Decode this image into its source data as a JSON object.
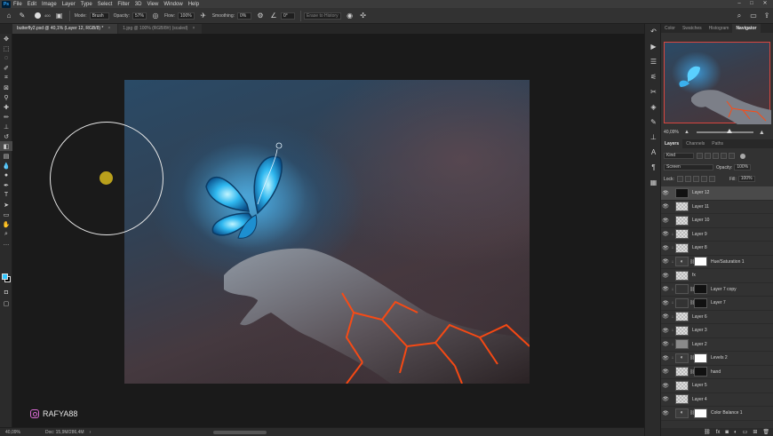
{
  "menu": [
    "File",
    "Edit",
    "Image",
    "Layer",
    "Type",
    "Select",
    "Filter",
    "3D",
    "View",
    "Window",
    "Help"
  ],
  "options": {
    "mode_label": "Mode:",
    "mode_value": "Brush",
    "opacity_label": "Opacity:",
    "opacity_value": "57%",
    "flow_label": "Flow:",
    "flow_value": "100%",
    "smoothing_label": "Smoothing:",
    "smoothing_value": "0%",
    "angle_value": "0°",
    "erase_history": "Erase to History",
    "brush_size": "400"
  },
  "tabs": [
    {
      "label": "butterfly2.psd @ 40,1% (Layer 12, RGB/8) *",
      "active": true
    },
    {
      "label": "1.jpg @ 100% (RGB/8#) (scaled)",
      "active": false
    }
  ],
  "watermark": "RAFYA88",
  "status": {
    "zoom": "40,09%",
    "doc": "Doc: 15,9M/286,4M"
  },
  "panel_tabs": [
    "Color",
    "Swatches",
    "Histogram",
    "Navigator"
  ],
  "navigator": {
    "zoom": "40,09%"
  },
  "layer_panel_tabs": [
    "Layers",
    "Channels",
    "Paths"
  ],
  "layer_controls": {
    "kind": "Kind",
    "blend_mode": "Screen",
    "opacity_label": "Opacity:",
    "opacity_value": "100%",
    "lock_label": "Lock:",
    "fill_label": "Fill:",
    "fill_value": "100%"
  },
  "layers": [
    {
      "name": "Layer 12",
      "thumb": "black",
      "selected": true
    },
    {
      "name": "Layer 11",
      "thumb": "trans"
    },
    {
      "name": "Layer 10",
      "thumb": "trans"
    },
    {
      "name": "Layer 9",
      "thumb": "trans",
      "clip": true
    },
    {
      "name": "Layer 8",
      "thumb": "trans",
      "clip": true
    },
    {
      "name": "Hue/Saturation 1",
      "thumb": "adj",
      "mask": "white",
      "clip": true
    },
    {
      "name": "fx",
      "thumb": "trans"
    },
    {
      "name": "Layer 7 copy",
      "thumb": "dark",
      "mask": "black",
      "clip": true
    },
    {
      "name": "Layer 7",
      "thumb": "dark",
      "mask": "black",
      "clip": true
    },
    {
      "name": "Layer 6",
      "thumb": "trans",
      "clip": true
    },
    {
      "name": "Layer 3",
      "thumb": "trans",
      "clip": true
    },
    {
      "name": "Layer 2",
      "thumb": "grey",
      "clip": true
    },
    {
      "name": "Levels 2",
      "thumb": "adj",
      "mask": "white",
      "clip": true
    },
    {
      "name": "hand",
      "thumb": "trans",
      "mask": "black"
    },
    {
      "name": "Layer 5",
      "thumb": "trans"
    },
    {
      "name": "Layer 4",
      "thumb": "trans"
    },
    {
      "name": "Color Balance 1",
      "thumb": "adj",
      "mask": "white"
    }
  ],
  "colors": {
    "foreground": "#31c6ff",
    "background": "#000000",
    "navigator_frame": "#d9463f",
    "accent": "#31a8ff"
  }
}
